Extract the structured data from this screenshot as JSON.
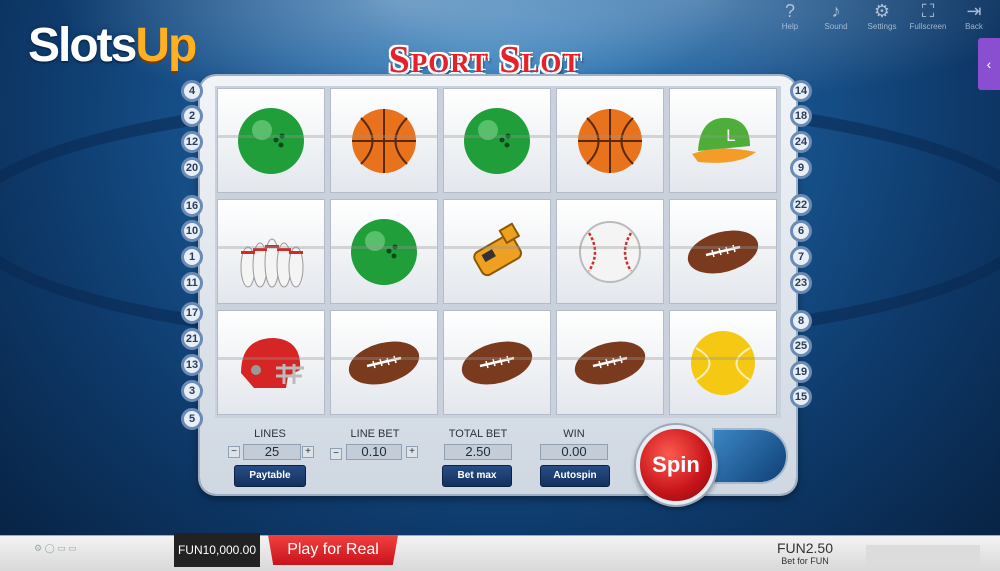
{
  "logo": {
    "part1": "Slots",
    "part2": "Up"
  },
  "title": "Sport Slot",
  "top_controls": [
    {
      "label": "Help",
      "icon": "question-icon",
      "glyph": "?"
    },
    {
      "label": "Sound",
      "icon": "sound-icon",
      "glyph": "♪"
    },
    {
      "label": "Settings",
      "icon": "gear-icon",
      "glyph": "⚙"
    },
    {
      "label": "Fullscreen",
      "icon": "fullscreen-icon",
      "glyph": "⛶"
    },
    {
      "label": "Back",
      "icon": "back-icon",
      "glyph": "⇥"
    }
  ],
  "side_tab_glyph": "‹",
  "left_lines": [
    "4",
    "2",
    "12",
    "20",
    "16",
    "10",
    "1",
    "11",
    "17",
    "21",
    "13",
    "3",
    "5"
  ],
  "right_lines": [
    "14",
    "18",
    "24",
    "9",
    "22",
    "6",
    "7",
    "23",
    "8",
    "25",
    "19",
    "15"
  ],
  "reels": [
    [
      "bowling-ball",
      "basketball",
      "bowling-ball",
      "basketball",
      "baseball-cap"
    ],
    [
      "bowling-pins",
      "bowling-ball",
      "whistle",
      "baseball",
      "american-football"
    ],
    [
      "football-helmet",
      "american-football",
      "american-football",
      "american-football",
      "tennis-ball"
    ]
  ],
  "controls": {
    "lines_label": "LINES",
    "lines_value": "25",
    "line_bet_label": "LINE BET",
    "line_bet_value": "0.10",
    "total_bet_label": "TOTAL BET",
    "total_bet_value": "2.50",
    "win_label": "WIN",
    "win_value": "0.00",
    "minus": "−",
    "plus": "+",
    "paytable": "Paytable",
    "bet_max": "Bet max",
    "autospin": "Autospin",
    "spin": "Spin"
  },
  "footer": {
    "balance": "FUN10,000.00",
    "play_real": "Play for Real",
    "bet_amount": "FUN2.50",
    "bet_sub": "Bet for FUN"
  },
  "colors": {
    "accent_red": "#e8202a",
    "frame": "#e6ebf1",
    "button_blue": "#14315e"
  }
}
